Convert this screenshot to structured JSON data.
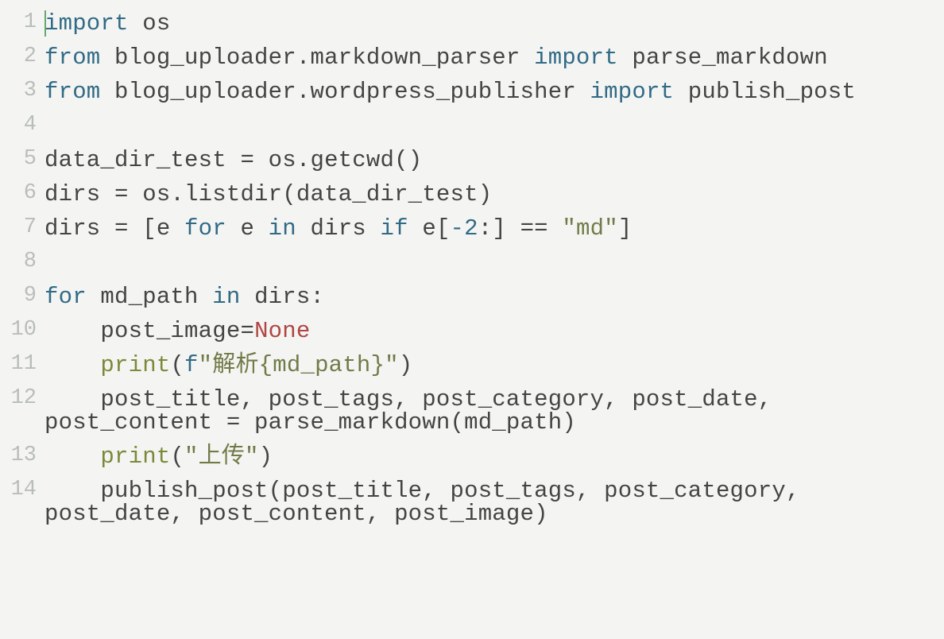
{
  "language": "python",
  "lines": [
    {
      "num": "1",
      "code": [
        {
          "t": "cursor"
        },
        {
          "t": "kw",
          "s": "import"
        },
        {
          "t": "ident",
          "s": " os"
        }
      ]
    },
    {
      "num": "2",
      "code": [
        {
          "t": "kw",
          "s": "from"
        },
        {
          "t": "ident",
          "s": " blog_uploader.markdown_parser "
        },
        {
          "t": "kw",
          "s": "import"
        },
        {
          "t": "ident",
          "s": " parse_markdown"
        }
      ]
    },
    {
      "num": "3",
      "code": [
        {
          "t": "kw",
          "s": "from"
        },
        {
          "t": "ident",
          "s": " blog_uploader.wordpress_publisher "
        },
        {
          "t": "kw",
          "s": "import"
        },
        {
          "t": "ident",
          "s": " publish_post"
        }
      ]
    },
    {
      "num": "4",
      "code": [
        {
          "t": "ident",
          "s": " "
        }
      ]
    },
    {
      "num": "5",
      "code": [
        {
          "t": "ident",
          "s": "data_dir_test "
        },
        {
          "t": "op",
          "s": "="
        },
        {
          "t": "ident",
          "s": " os.getcwd()"
        }
      ]
    },
    {
      "num": "6",
      "code": [
        {
          "t": "ident",
          "s": "dirs "
        },
        {
          "t": "op",
          "s": "="
        },
        {
          "t": "ident",
          "s": " os.listdir(data_dir_test)"
        }
      ]
    },
    {
      "num": "7",
      "code": [
        {
          "t": "ident",
          "s": "dirs "
        },
        {
          "t": "op",
          "s": "="
        },
        {
          "t": "ident",
          "s": " [e "
        },
        {
          "t": "kw",
          "s": "for"
        },
        {
          "t": "ident",
          "s": " e "
        },
        {
          "t": "kw",
          "s": "in"
        },
        {
          "t": "ident",
          "s": " dirs "
        },
        {
          "t": "kw",
          "s": "if"
        },
        {
          "t": "ident",
          "s": " e["
        },
        {
          "t": "num",
          "s": "-2"
        },
        {
          "t": "ident",
          "s": ":] "
        },
        {
          "t": "op",
          "s": "=="
        },
        {
          "t": "ident",
          "s": " "
        },
        {
          "t": "str",
          "s": "\"md\""
        },
        {
          "t": "ident",
          "s": "]"
        }
      ]
    },
    {
      "num": "8",
      "code": [
        {
          "t": "ident",
          "s": " "
        }
      ]
    },
    {
      "num": "9",
      "code": [
        {
          "t": "kw",
          "s": "for"
        },
        {
          "t": "ident",
          "s": " md_path "
        },
        {
          "t": "kw",
          "s": "in"
        },
        {
          "t": "ident",
          "s": " dirs:"
        }
      ]
    },
    {
      "num": "10",
      "code": [
        {
          "t": "ident",
          "s": "    post_image"
        },
        {
          "t": "op",
          "s": "="
        },
        {
          "t": "none",
          "s": "None"
        }
      ]
    },
    {
      "num": "11",
      "code": [
        {
          "t": "ident",
          "s": "    "
        },
        {
          "t": "builtin",
          "s": "print"
        },
        {
          "t": "ident",
          "s": "("
        },
        {
          "t": "fstr",
          "s": "f"
        },
        {
          "t": "str",
          "s": "\"解析{md_path}\""
        },
        {
          "t": "ident",
          "s": ")"
        }
      ]
    },
    {
      "num": "12",
      "code": [
        {
          "t": "ident",
          "s": "    post_title, post_tags, post_category, post_date, post_content "
        },
        {
          "t": "op",
          "s": "="
        },
        {
          "t": "ident",
          "s": " parse_markdown(md_path)"
        }
      ]
    },
    {
      "num": "13",
      "code": [
        {
          "t": "ident",
          "s": "    "
        },
        {
          "t": "builtin",
          "s": "print"
        },
        {
          "t": "ident",
          "s": "("
        },
        {
          "t": "str",
          "s": "\"上传\""
        },
        {
          "t": "ident",
          "s": ")"
        }
      ]
    },
    {
      "num": "14",
      "code": [
        {
          "t": "ident",
          "s": "    publish_post(post_title, post_tags, post_category, post_date, post_content, post_image)"
        }
      ]
    }
  ]
}
